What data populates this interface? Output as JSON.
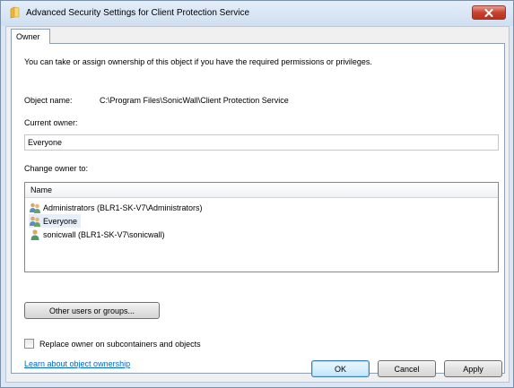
{
  "window": {
    "title": "Advanced Security Settings for Client Protection Service",
    "colors": {
      "title_bg": "#cfdff0",
      "close_button": "#c7432f",
      "link": "#0066cc",
      "selection": "#e5eef9"
    }
  },
  "tabs": [
    {
      "label": "Owner",
      "selected": true
    }
  ],
  "owner_panel": {
    "intro": "You can take or assign ownership of this object if you have the required permissions or privileges.",
    "object_name_label": "Object name:",
    "object_name_value": "C:\\Program Files\\SonicWall\\Client Protection Service",
    "current_owner_label": "Current owner:",
    "current_owner_value": "Everyone",
    "change_owner_label": "Change owner to:",
    "list": {
      "column_header": "Name",
      "items": [
        {
          "label": "Administrators (BLR1-SK-V7\\Administrators)",
          "icon": "group-icon",
          "selected": false
        },
        {
          "label": "Everyone",
          "icon": "group-icon",
          "selected": true
        },
        {
          "label": "sonicwall (BLR1-SK-V7\\sonicwall)",
          "icon": "user-icon",
          "selected": false
        }
      ]
    },
    "other_users_button": "Other users or groups...",
    "replace_owner_checkbox": {
      "label": "Replace owner on subcontainers and objects",
      "checked": false
    },
    "learn_link": "Learn about object ownership"
  },
  "footer": {
    "ok": "OK",
    "cancel": "Cancel",
    "apply": "Apply"
  }
}
